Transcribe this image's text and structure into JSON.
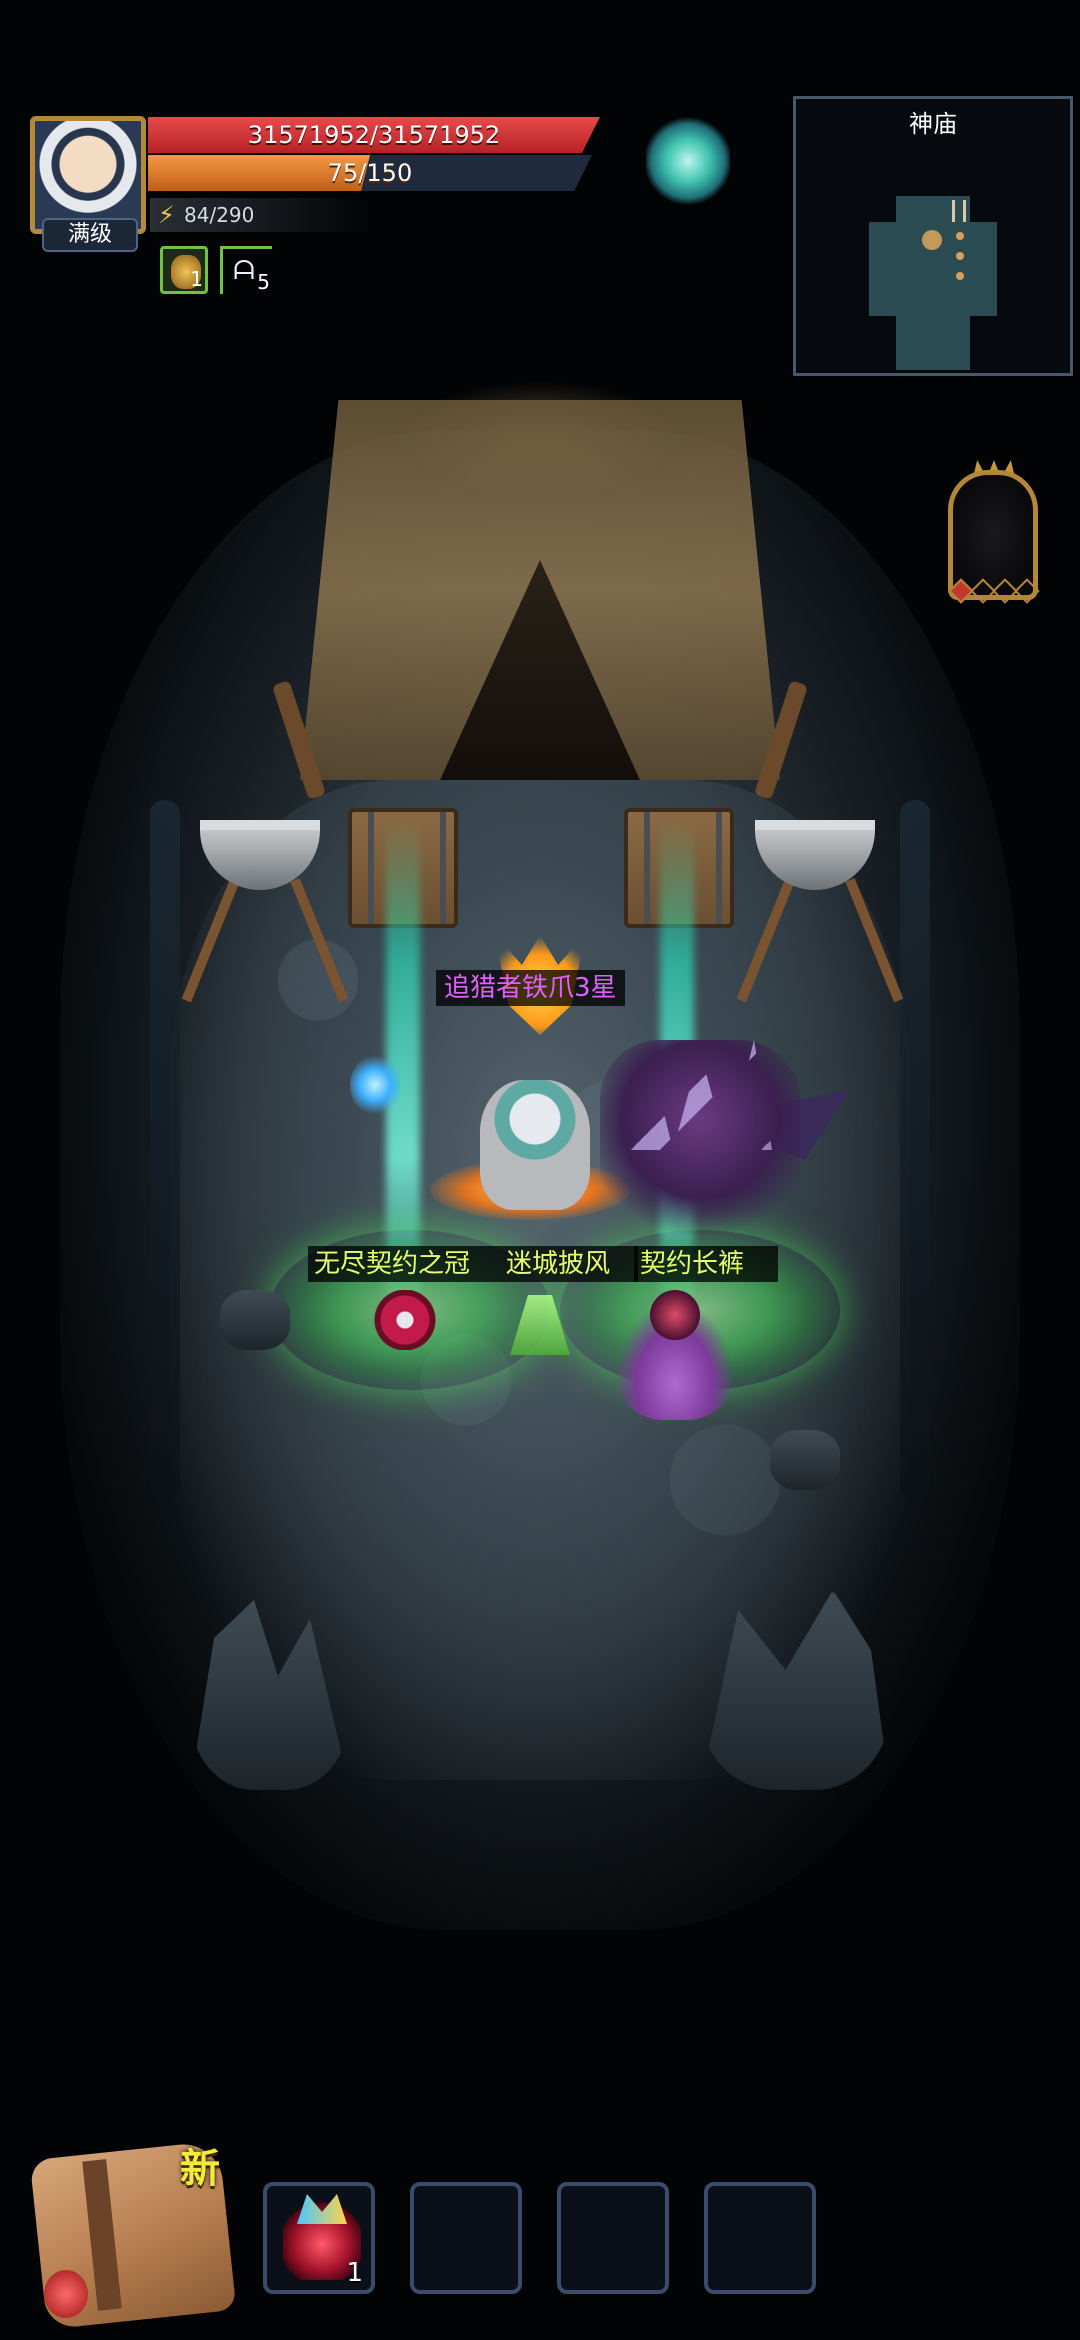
{
  "player": {
    "level_label": "满级",
    "hp_text": "31571952/31571952",
    "hp_fraction": 1.0,
    "mp_text": "75/150",
    "mp_fraction": 0.5,
    "energy_text": "84/290",
    "energy_fraction": 0.29
  },
  "buffs": [
    {
      "icon": "shell-buff-icon",
      "count": "1"
    },
    {
      "icon": "wolf-buff-icon",
      "count": "5"
    }
  ],
  "minimap": {
    "title": "神庙"
  },
  "scene": {
    "labels": {
      "monster": "追猎者铁爪3星",
      "crown": "无尽契约之冠",
      "cloak": "迷城披风",
      "pants": "契约长裤"
    }
  },
  "bottom": {
    "new_badge": "新",
    "slots": [
      {
        "item": "potion-item-icon",
        "count": "1"
      },
      {
        "item": "",
        "count": ""
      },
      {
        "item": "",
        "count": ""
      },
      {
        "item": "",
        "count": ""
      }
    ]
  },
  "colors": {
    "hp": "#d1302f",
    "mp": "#e07a2a",
    "label_purple": "#e060ff",
    "label_green": "#e8ff6c",
    "portal_green": "#5ee65a",
    "beam_cyan": "#28ffd2"
  }
}
